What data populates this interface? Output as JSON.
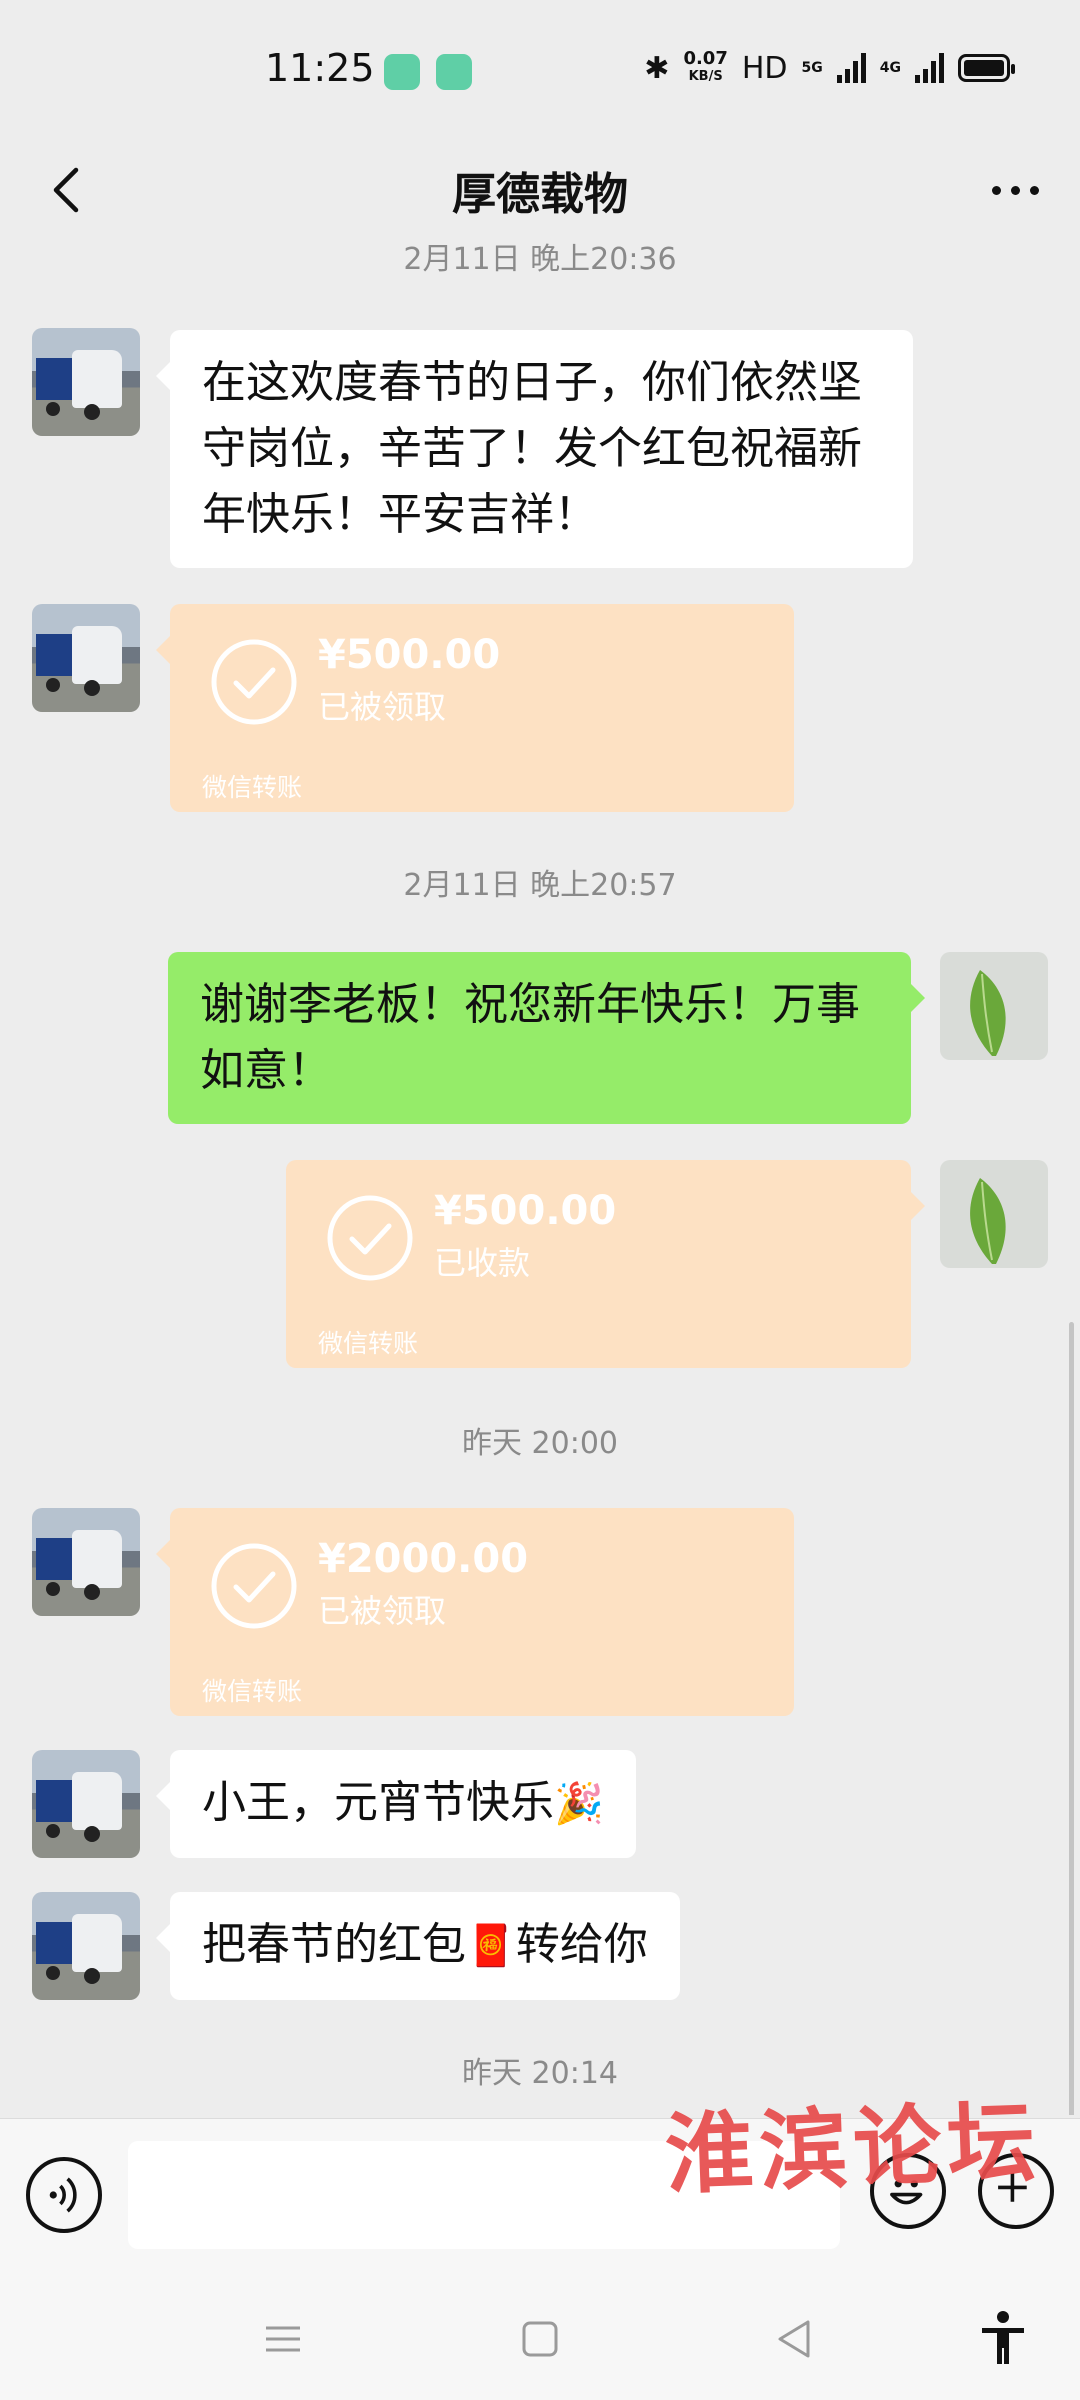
{
  "status_bar": {
    "time": "11:25",
    "net_speed_value": "0.07",
    "net_speed_unit": "KB/S",
    "hd_label": "HD",
    "sim1_label": "5G",
    "sim2_label": "4G"
  },
  "header": {
    "title": "厚德载物"
  },
  "messages": {
    "ts1": "2月11日 晚上20:36",
    "msg1": "在这欢度春节的日子，你们依然坚守岗位，辛苦了！发个红包祝福新年快乐！平安吉祥！",
    "tf1": {
      "amount": "¥500.00",
      "status": "已被领取",
      "label": "微信转账"
    },
    "ts2": "2月11日 晚上20:57",
    "msg2": "谢谢李老板！祝您新年快乐！万事如意！",
    "tf2": {
      "amount": "¥500.00",
      "status": "已收款",
      "label": "微信转账"
    },
    "ts3": "昨天 20:00",
    "tf3": {
      "amount": "¥2000.00",
      "status": "已被领取",
      "label": "微信转账"
    },
    "msg3": "小王，元宵节快乐",
    "msg3_emoji": "🎉",
    "msg4_a": "把春节的红包",
    "msg4_emoji": "🧧",
    "msg4_b": "转给你",
    "ts4": "昨天 20:14"
  },
  "watermark": "淮滨论坛",
  "colors": {
    "background": "#ededed",
    "sent_bubble": "#95ec69",
    "received_bubble": "#ffffff",
    "transfer_card": "#fde1c3",
    "watermark": "#e74b4b"
  },
  "icons": {
    "back": "chevron-left-icon",
    "more": "more-dots-icon",
    "voice": "voice-icon",
    "emoji": "emoji-icon",
    "plus": "plus-icon",
    "transfer_check": "check-circle-icon",
    "nav_menu": "menu-icon",
    "nav_home": "home-square-icon",
    "nav_back": "back-triangle-icon",
    "accessibility": "accessibility-icon"
  }
}
